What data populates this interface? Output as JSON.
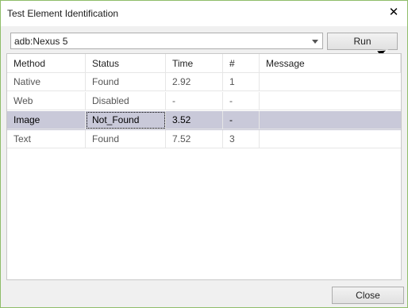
{
  "window": {
    "title": "Test Element Identification",
    "close_glyph": "✕",
    "border_color": "#8fbd6a"
  },
  "toolbar": {
    "device_value": "adb:Nexus 5",
    "run_label": "Run"
  },
  "table": {
    "columns": [
      "Method",
      "Status",
      "Time",
      "#",
      "Message"
    ],
    "rows": [
      {
        "method": "Native",
        "status": "Found",
        "time": "2.92",
        "count": "1",
        "message": ""
      },
      {
        "method": "Web",
        "status": "Disabled",
        "time": "-",
        "count": "-",
        "message": ""
      },
      {
        "method": "Image",
        "status": "Not_Found",
        "time": "3.52",
        "count": "-",
        "message": ""
      },
      {
        "method": "Text",
        "status": "Found",
        "time": "7.52",
        "count": "3",
        "message": ""
      }
    ],
    "selected_row": 2,
    "selection_color": "#c9c9d9"
  },
  "footer": {
    "close_label": "Close"
  },
  "icons": {
    "dropdown": "chevron-down-icon",
    "pointer": "mouse-pointer-icon"
  }
}
